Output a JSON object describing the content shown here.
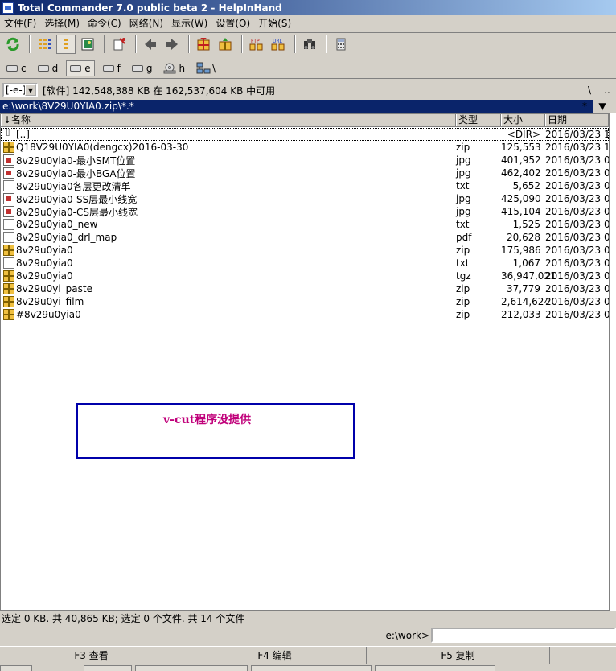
{
  "window": {
    "title": "Total Commander 7.0 public beta 2 - HelpInHand"
  },
  "menu": [
    "文件(F)",
    "选择(M)",
    "命令(C)",
    "网络(N)",
    "显示(W)",
    "设置(O)",
    "开始(S)"
  ],
  "toolbar": {
    "icons": [
      "refresh-icon",
      "brief-view-icon",
      "full-view-icon",
      "thumbnail-view-icon",
      "invert-selection-icon",
      "back-icon",
      "forward-icon",
      "pack-icon",
      "unpack-icon",
      "ftp-connect-icon",
      "url-connect-icon",
      "search-icon",
      "calculator-icon"
    ]
  },
  "drives": [
    {
      "letter": "c"
    },
    {
      "letter": "d"
    },
    {
      "letter": "e",
      "active": true
    },
    {
      "letter": "f"
    },
    {
      "letter": "g"
    },
    {
      "letter": "h"
    },
    {
      "letter": "\\"
    }
  ],
  "pathbar": {
    "drive_select": "[-e-]",
    "free_space": "[软件]  142,548,388 KB 在 162,537,604 KB 中可用",
    "root_btn": "\\",
    "up_btn": ".."
  },
  "current_path": {
    "value": "e:\\work\\8V29U0YIA0.zip\\*.*",
    "star_btn": "*",
    "dropdown_btn": "▼"
  },
  "columns": {
    "name": "↓名称",
    "type": "类型",
    "size": "大小",
    "date": "日期"
  },
  "files": [
    {
      "icon": "up",
      "name": "[..]",
      "type": "",
      "size": "<DIR>",
      "date": "2016/03/23 1"
    },
    {
      "icon": "zip",
      "name": "Q18V29U0YIA0(dengcx)2016-03-30",
      "type": "zip",
      "size": "125,553",
      "date": "2016/03/23 1"
    },
    {
      "icon": "jpg",
      "name": "8v29u0yia0-最小SMT位置",
      "type": "jpg",
      "size": "401,952",
      "date": "2016/03/23 0"
    },
    {
      "icon": "jpg",
      "name": "8v29u0yia0-最小BGA位置",
      "type": "jpg",
      "size": "462,402",
      "date": "2016/03/23 0"
    },
    {
      "icon": "doc",
      "name": "8v29u0yia0各层更改清单",
      "type": "txt",
      "size": "5,652",
      "date": "2016/03/23 0"
    },
    {
      "icon": "jpg",
      "name": "8v29u0yia0-SS层最小线宽",
      "type": "jpg",
      "size": "425,090",
      "date": "2016/03/23 0"
    },
    {
      "icon": "jpg",
      "name": "8v29u0yia0-CS层最小线宽",
      "type": "jpg",
      "size": "415,104",
      "date": "2016/03/23 0"
    },
    {
      "icon": "doc",
      "name": "8v29u0yia0_new",
      "type": "txt",
      "size": "1,525",
      "date": "2016/03/23 0"
    },
    {
      "icon": "doc",
      "name": "8v29u0yia0_drl_map",
      "type": "pdf",
      "size": "20,628",
      "date": "2016/03/23 0"
    },
    {
      "icon": "zip",
      "name": "8v29u0yia0",
      "type": "zip",
      "size": "175,986",
      "date": "2016/03/23 0"
    },
    {
      "icon": "doc",
      "name": "8v29u0yia0",
      "type": "txt",
      "size": "1,067",
      "date": "2016/03/23 0"
    },
    {
      "icon": "zip",
      "name": "8v29u0yia0",
      "type": "tgz",
      "size": "36,947,021",
      "date": "2016/03/23 0"
    },
    {
      "icon": "zip",
      "name": "8v29u0yi_paste",
      "type": "zip",
      "size": "37,779",
      "date": "2016/03/23 0"
    },
    {
      "icon": "zip",
      "name": "8v29u0yi_film",
      "type": "zip",
      "size": "2,614,624",
      "date": "2016/03/23 0"
    },
    {
      "icon": "zip",
      "name": "#8v29u0yia0",
      "type": "zip",
      "size": "212,033",
      "date": "2016/03/23 0"
    }
  ],
  "annotation": {
    "text": "v-cut程序没提供",
    "color": "#c0007a",
    "border_color": "#0000aa"
  },
  "status": "选定 0 KB. 共 40,865 KB; 选定 0 个文件. 共 14 个文件",
  "cmdline": {
    "label": "e:\\work>",
    "value": ""
  },
  "fkeys": [
    "F3 查看",
    "F4 编辑",
    "F5 复制"
  ],
  "colors": {
    "title_gradient_start": "#0a246a",
    "title_gradient_end": "#a6caf0",
    "path_highlight": "#0a246a",
    "window_bg": "#d4d0c8"
  }
}
